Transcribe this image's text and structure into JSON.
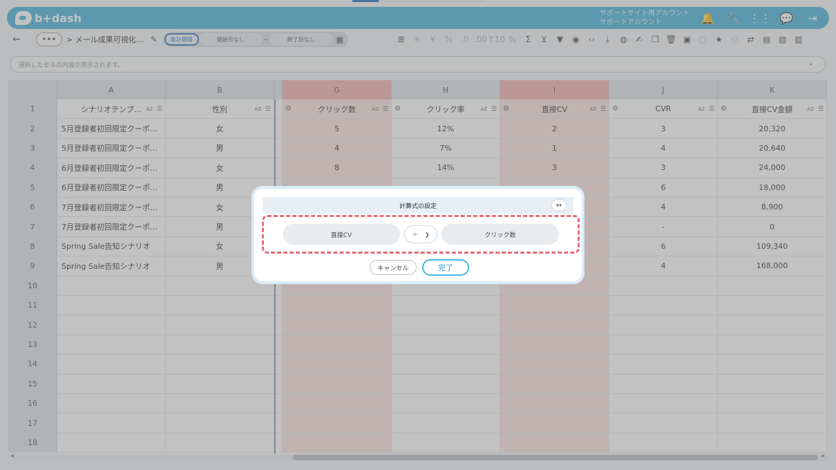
{
  "app": {
    "logo": "b+dash"
  },
  "header": {
    "account_line1": "サポートサイト用アカウント",
    "account_line2": "サポートアカウント",
    "icons": [
      "bell-icon",
      "wrench-icon",
      "apps-grid-icon",
      "chat-icon",
      "logout-icon"
    ]
  },
  "toolbar": {
    "more": "•••",
    "breadcrumb": "> メール成果可視化…",
    "period_label": "集計期間",
    "start_placeholder": "開始日なし",
    "tilde": "~",
    "end_placeholder": "終了日なし"
  },
  "selbar": {
    "placeholder": "選択したセルの内容が表示されます。"
  },
  "sheet": {
    "columns": [
      "A",
      "B",
      "G",
      "H",
      "I",
      "J",
      "K"
    ],
    "headers": [
      "シナリオテンプ…",
      "性別",
      "クリック数",
      "クリック率",
      "直接CV",
      "CVR",
      "直接CV金額"
    ],
    "rows": [
      [
        "5月登録者初回限定クーポ…",
        "女",
        "5",
        "12%",
        "2",
        "3",
        "20,320"
      ],
      [
        "5月登録者初回限定クーポ…",
        "男",
        "4",
        "7%",
        "1",
        "4",
        "20,640"
      ],
      [
        "6月登録者初回限定クーポ…",
        "女",
        "8",
        "14%",
        "3",
        "3",
        "24,000"
      ],
      [
        "6月登録者初回限定クーポ…",
        "男",
        "",
        "",
        "",
        "6",
        "18,000"
      ],
      [
        "7月登録者初回限定クーポ…",
        "女",
        "",
        "",
        "",
        "4",
        "8,900"
      ],
      [
        "7月登録者初回限定クーポ…",
        "男",
        "",
        "",
        "",
        "-",
        "0"
      ],
      [
        "Spring Sale告知シナリオ",
        "女",
        "",
        "",
        "",
        "6",
        "109,340"
      ],
      [
        "Spring Sale告知シナリオ",
        "男",
        "",
        "",
        "",
        "4",
        "168,000"
      ]
    ],
    "row_numbers": [
      "1",
      "2",
      "3",
      "4",
      "5",
      "6",
      "7",
      "8",
      "9",
      "10",
      "11",
      "12",
      "13",
      "14",
      "15",
      "16",
      "17",
      "18"
    ]
  },
  "modal": {
    "title": "計算式の設定",
    "expand": "↔",
    "left_operand": "直接CV",
    "operator": "÷",
    "right_operand": "クリック数",
    "cancel": "キャンセル",
    "ok": "完了"
  }
}
